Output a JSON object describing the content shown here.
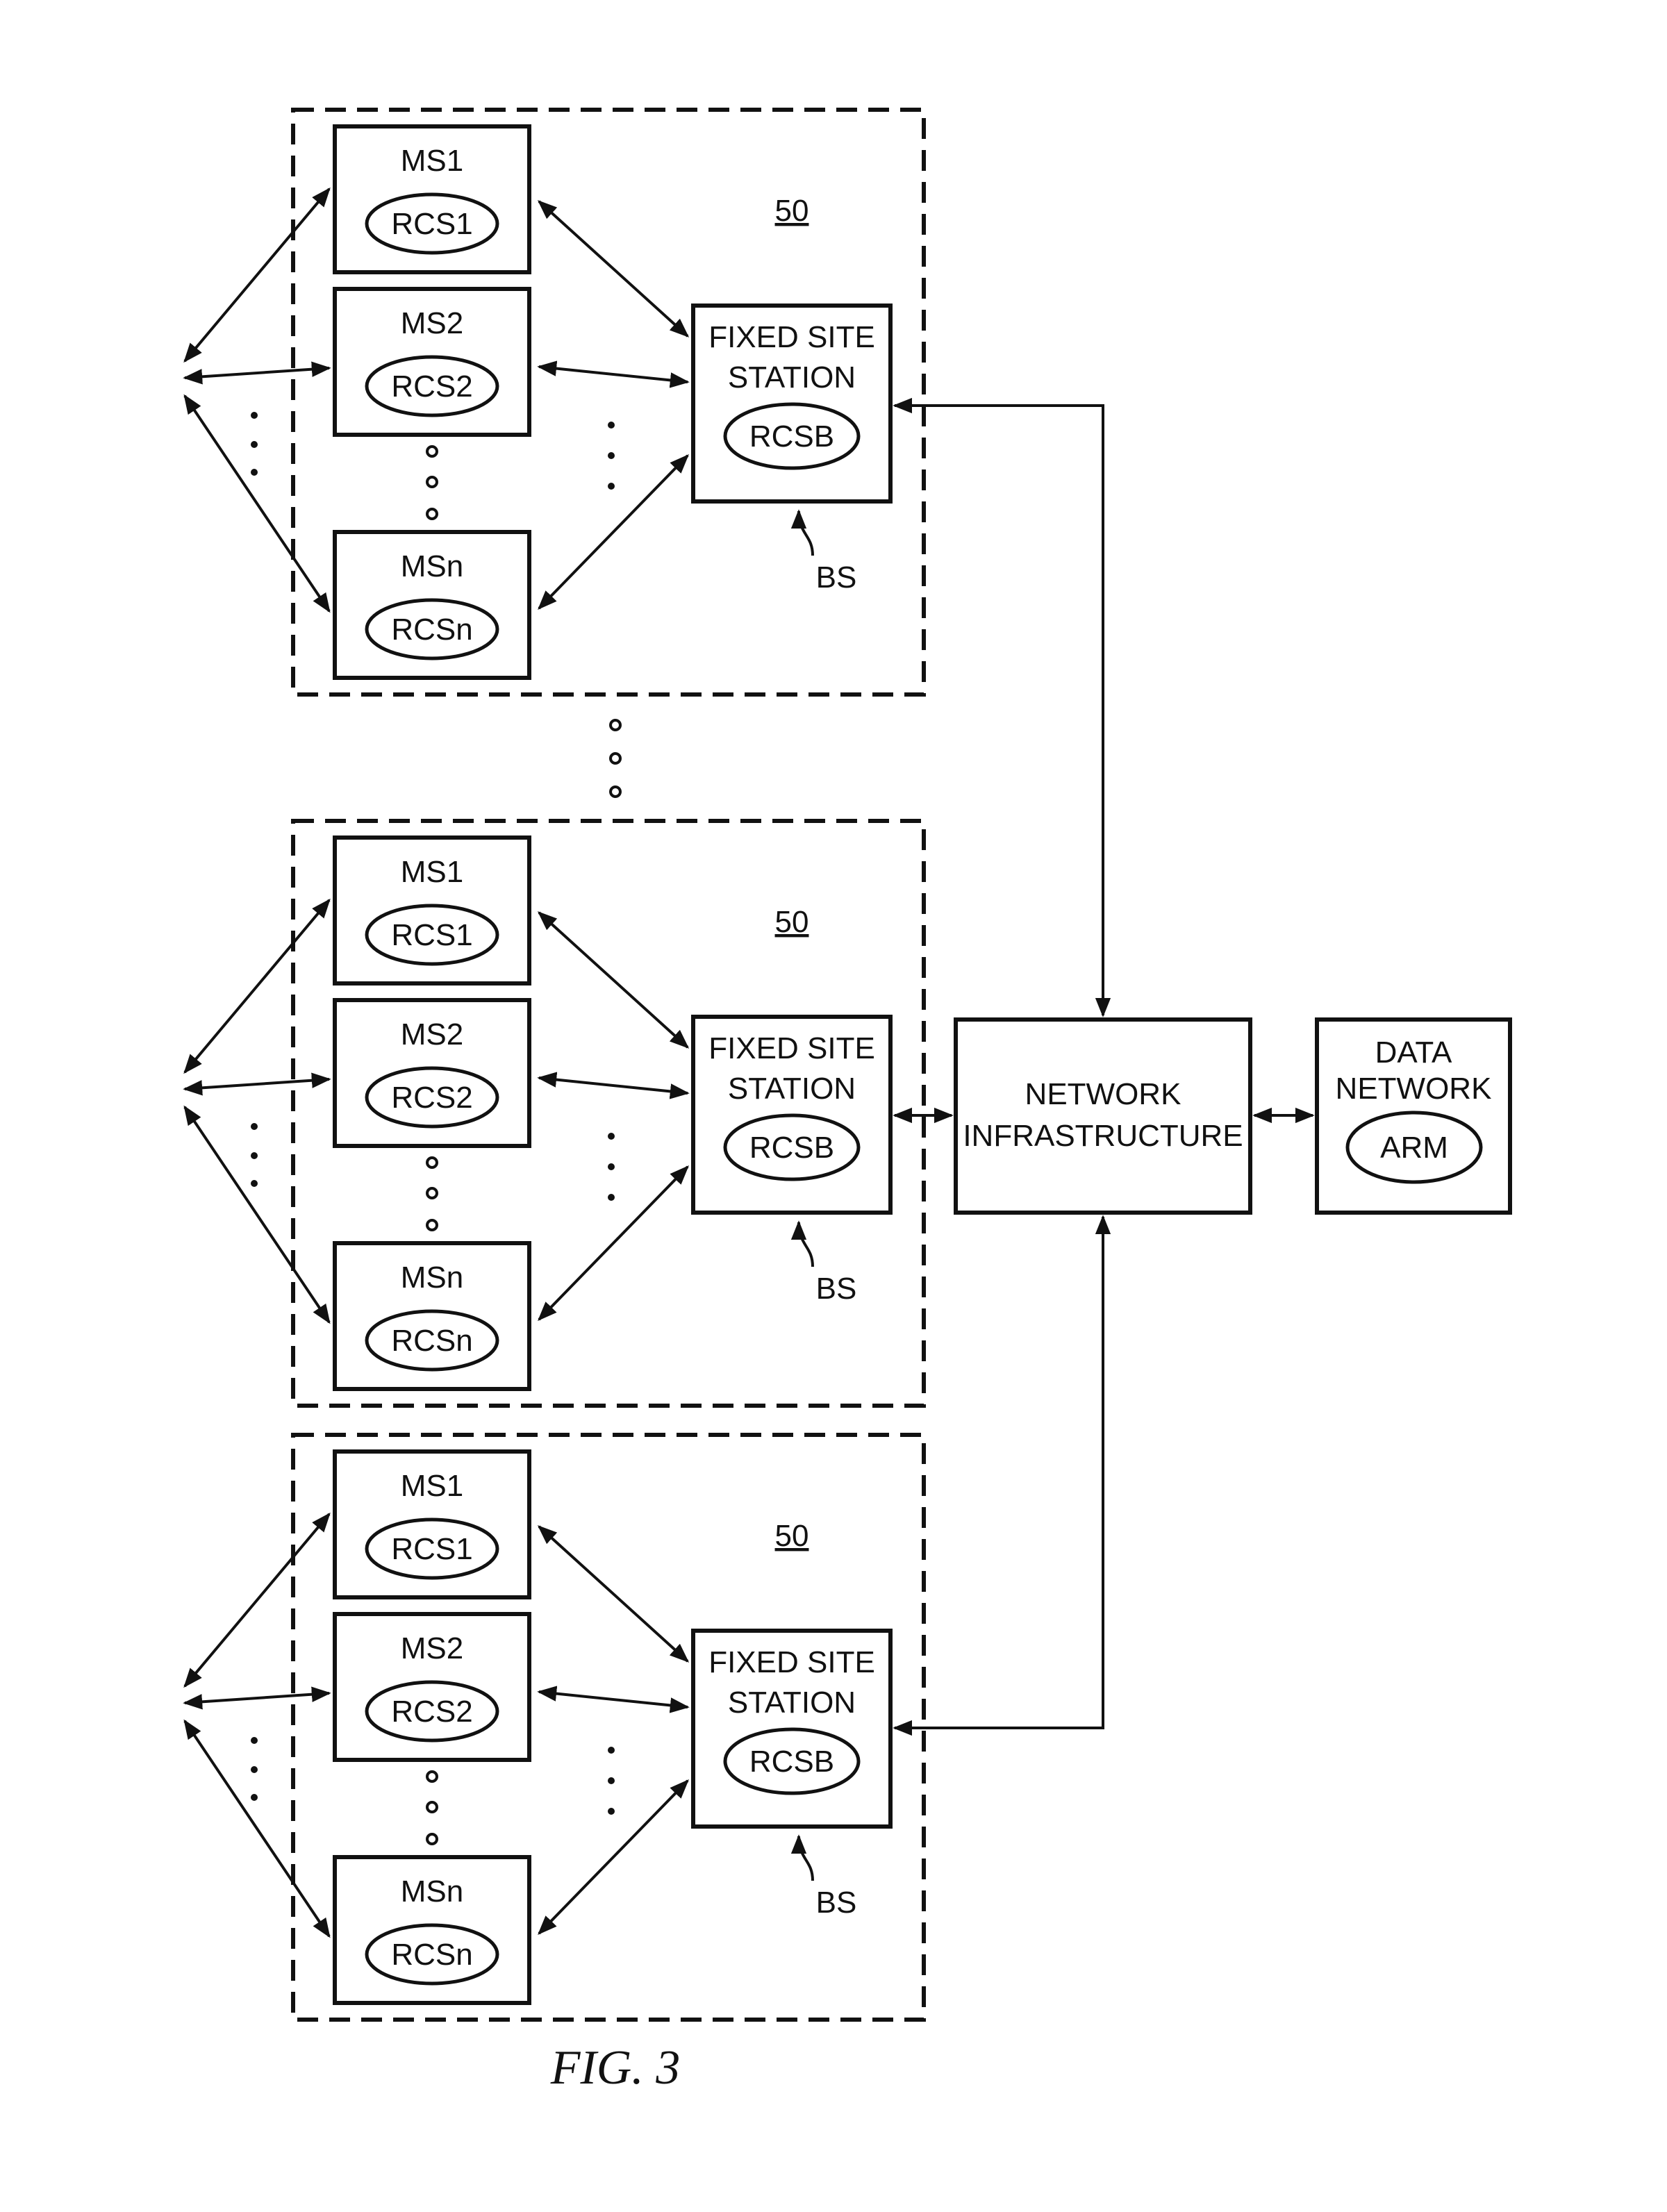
{
  "figure": {
    "caption": "FIG. 3",
    "network_infrastructure": {
      "line1": "NETWORK",
      "line2": "INFRASTRUCTURE"
    },
    "data_network": {
      "line1": "DATA",
      "line2": "NETWORK",
      "component": "ARM"
    },
    "clusters": [
      {
        "ref": "50",
        "mobiles": [
          {
            "name": "MS1",
            "component": "RCS1"
          },
          {
            "name": "MS2",
            "component": "RCS2"
          },
          {
            "name": "MSn",
            "component": "RCSn"
          }
        ],
        "base_station": {
          "line1": "FIXED SITE",
          "line2": "STATION",
          "component": "RCSB",
          "label": "BS"
        }
      },
      {
        "ref": "50",
        "mobiles": [
          {
            "name": "MS1",
            "component": "RCS1"
          },
          {
            "name": "MS2",
            "component": "RCS2"
          },
          {
            "name": "MSn",
            "component": "RCSn"
          }
        ],
        "base_station": {
          "line1": "FIXED SITE",
          "line2": "STATION",
          "component": "RCSB",
          "label": "BS"
        }
      },
      {
        "ref": "50",
        "mobiles": [
          {
            "name": "MS1",
            "component": "RCS1"
          },
          {
            "name": "MS2",
            "component": "RCS2"
          },
          {
            "name": "MSn",
            "component": "RCSn"
          }
        ],
        "base_station": {
          "line1": "FIXED SITE",
          "line2": "STATION",
          "component": "RCSB",
          "label": "BS"
        }
      }
    ]
  }
}
